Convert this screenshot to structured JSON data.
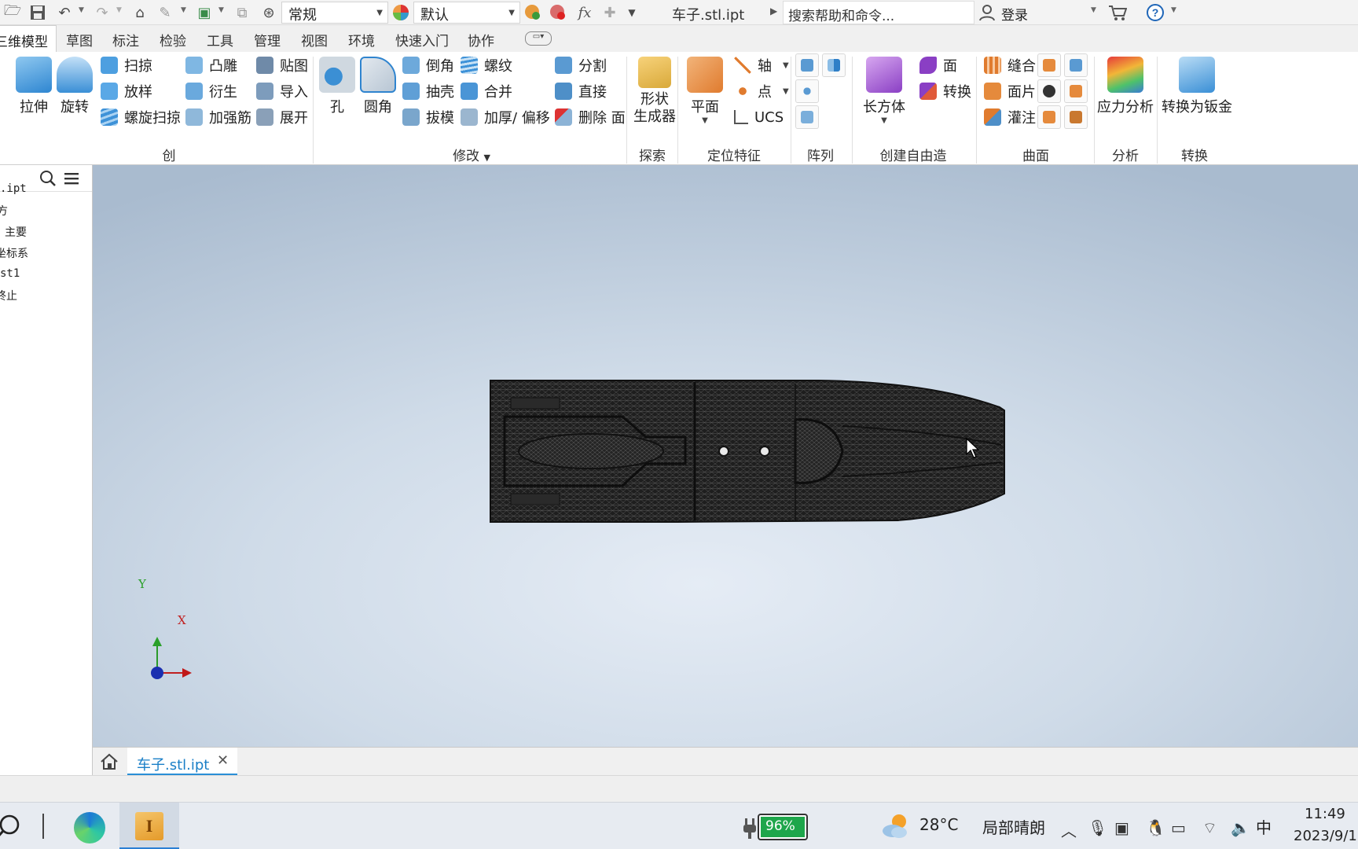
{
  "quick_access": {
    "appearance_select": "常规",
    "material_select": "默认",
    "document_title": "车子.stl.ipt",
    "search_placeholder": "搜索帮助和命令...",
    "login_label": "登录",
    "fx_label": "fx"
  },
  "ribbon_tabs": [
    "三维模型",
    "草图",
    "标注",
    "检验",
    "工具",
    "管理",
    "视图",
    "环境",
    "快速入门",
    "协作"
  ],
  "ribbon": {
    "create": {
      "extrude": "拉伸",
      "revolve": "旋转",
      "sweep": "扫掠",
      "loft": "放样",
      "coil": "螺旋扫掠",
      "emboss": "凸雕",
      "derive": "衍生",
      "rib": "加强筋",
      "decal": "贴图",
      "import": "导入",
      "unwrap": "展开",
      "label": "创建"
    },
    "modify": {
      "hole": "孔",
      "fillet": "圆角",
      "chamfer": "倒角",
      "shell": "抽壳",
      "draft": "拔模",
      "thread": "螺纹",
      "combine": "合并",
      "thicken": "加厚/ 偏移",
      "split": "分割",
      "direct": "直接",
      "delete_face": "删除 面",
      "label": "修改"
    },
    "explore": {
      "shape_generator_1": "形状",
      "shape_generator_2": "生成器",
      "label": "探索"
    },
    "work_features": {
      "plane": "平面",
      "axis": "轴",
      "point": "点",
      "ucs": "UCS",
      "label": "定位特征"
    },
    "pattern": {
      "label": "阵列"
    },
    "freeform": {
      "box": "长方体",
      "face": "面",
      "convert": "转换",
      "label": "创建自由造型"
    },
    "surface": {
      "stitch": "缝合",
      "patch": "面片",
      "sculpt": "灌注",
      "label": "曲面"
    },
    "analysis": {
      "stress": "应力分析",
      "label": "分析"
    },
    "convert": {
      "to_sheet_metal": "转换为钣金",
      "label": "转换"
    }
  },
  "browser": {
    "items": [
      ".ipt",
      "方",
      "主要",
      "坐标系",
      "st1",
      "终止"
    ]
  },
  "triad": {
    "x": "X",
    "y": "Y"
  },
  "document_tab": {
    "name": "车子.stl.ipt",
    "close": "✕"
  },
  "taskbar": {
    "battery": "96%",
    "temperature": "28°C",
    "weather": "局部晴朗",
    "ime": "中",
    "time": "11:49",
    "date": "2023/9/1"
  },
  "colors": {
    "accent": "#1a7fc7",
    "model": "#1e1e1e",
    "viewport_center": "#e5ecf5",
    "viewport_edge": "#a9bbcf"
  }
}
